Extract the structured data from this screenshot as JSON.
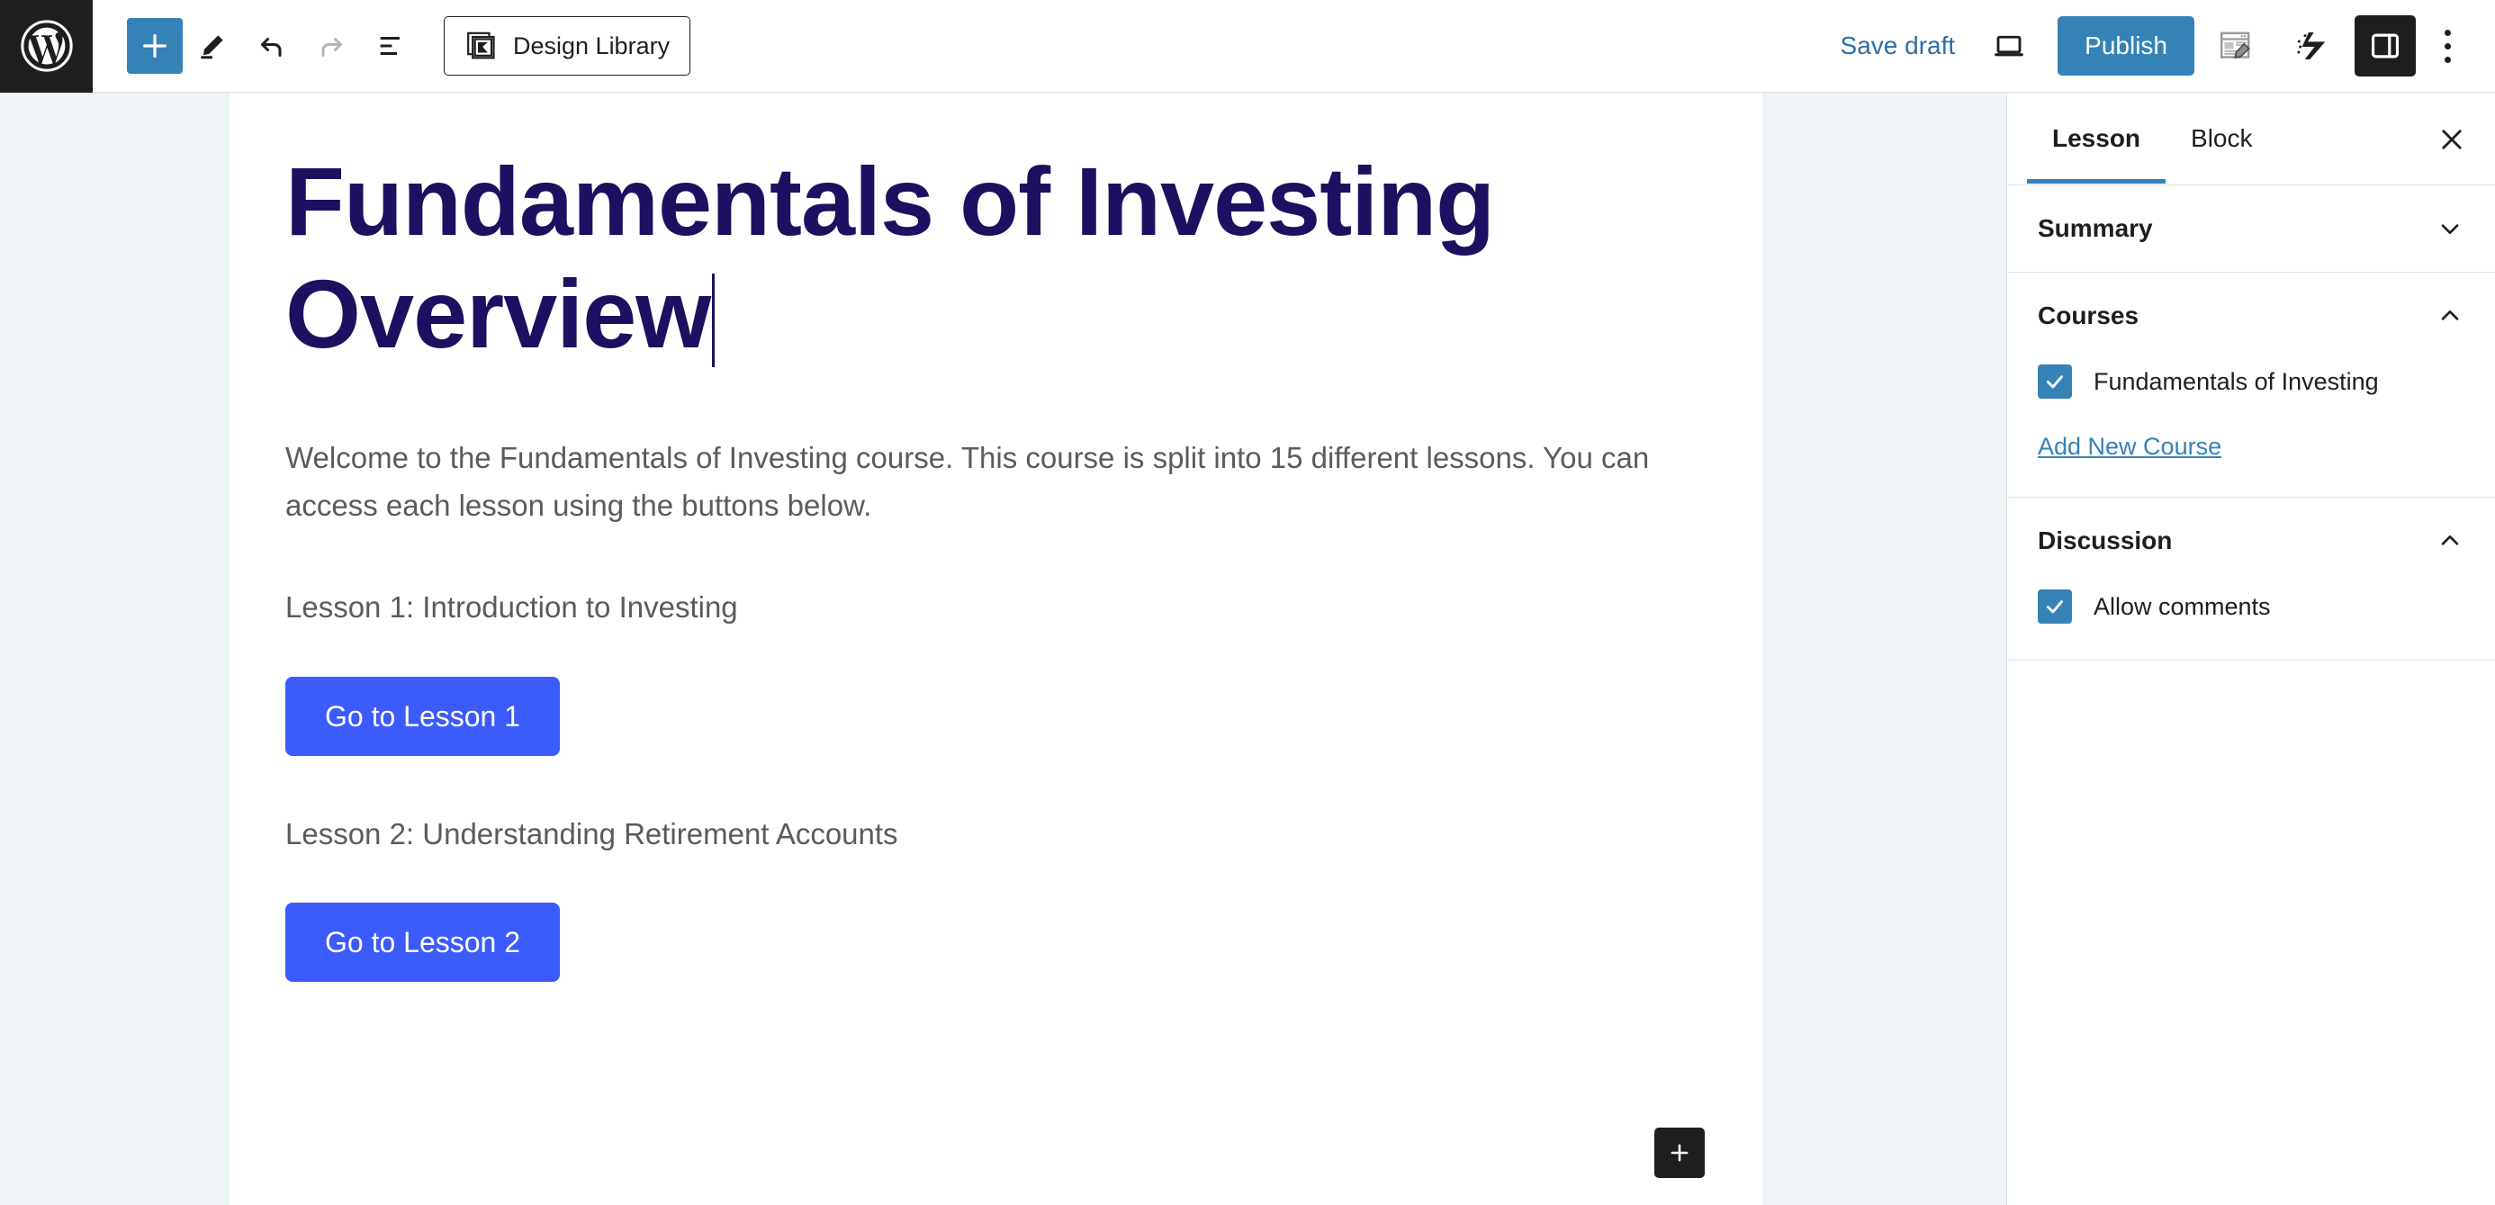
{
  "toolbar": {
    "logo_icon": "wordpress-logo-icon",
    "add_block_label": "+",
    "add_block_icon": "plus-icon",
    "tools_icon": "pencil-icon",
    "undo_icon": "undo-arrow-icon",
    "redo_icon": "redo-arrow-icon",
    "list_view_icon": "list-view-icon",
    "design_library_label": "Design Library",
    "design_library_icon": "design-library-icon",
    "save_draft_label": "Save draft",
    "preview_icon": "desktop-preview-icon",
    "publish_label": "Publish",
    "post_edit_icon": "post-edit-icon",
    "kadence_icon": "kadence-logo-icon",
    "settings_sidebar_icon": "sidebar-toggle-icon",
    "more_options_icon": "three-dots-vertical-icon"
  },
  "editor": {
    "title": "Fundamentals of Investing Overview",
    "intro_paragraph": "Welcome to the Fundamentals of Investing course. This course is split into 15 different lessons. You can access each lesson using the buttons below.",
    "blocks": [
      {
        "lesson_label": "Lesson 1: Introduction to Investing",
        "button_label": "Go to Lesson 1"
      },
      {
        "lesson_label": "Lesson 2: Understanding Retirement Accounts",
        "button_label": "Go to Lesson 2"
      }
    ],
    "appender_label": "+",
    "appender_icon": "plus-icon"
  },
  "sidebar": {
    "tabs": [
      {
        "label": "Lesson",
        "active": true
      },
      {
        "label": "Block",
        "active": false
      }
    ],
    "close_icon": "close-x-icon",
    "panels": [
      {
        "title": "Summary",
        "chevron_icon": "chevron-down-icon",
        "expanded": false
      },
      {
        "title": "Courses",
        "chevron_icon": "chevron-up-icon",
        "expanded": true,
        "checkboxes": [
          {
            "label": "Fundamentals of Investing",
            "checked": true
          }
        ],
        "link_label": "Add New Course"
      },
      {
        "title": "Discussion",
        "chevron_icon": "chevron-up-icon",
        "expanded": true,
        "checkboxes": [
          {
            "label": "Allow comments",
            "checked": true
          }
        ]
      }
    ]
  },
  "colors": {
    "wp_admin_bar": "#1e1e1e",
    "accent_blue": "#3582b7",
    "title_navy": "#1e1060",
    "lesson_button_blue": "#3b5bfc",
    "canvas_gutter": "#eef4f8",
    "body_text": "#5b5b5b"
  }
}
